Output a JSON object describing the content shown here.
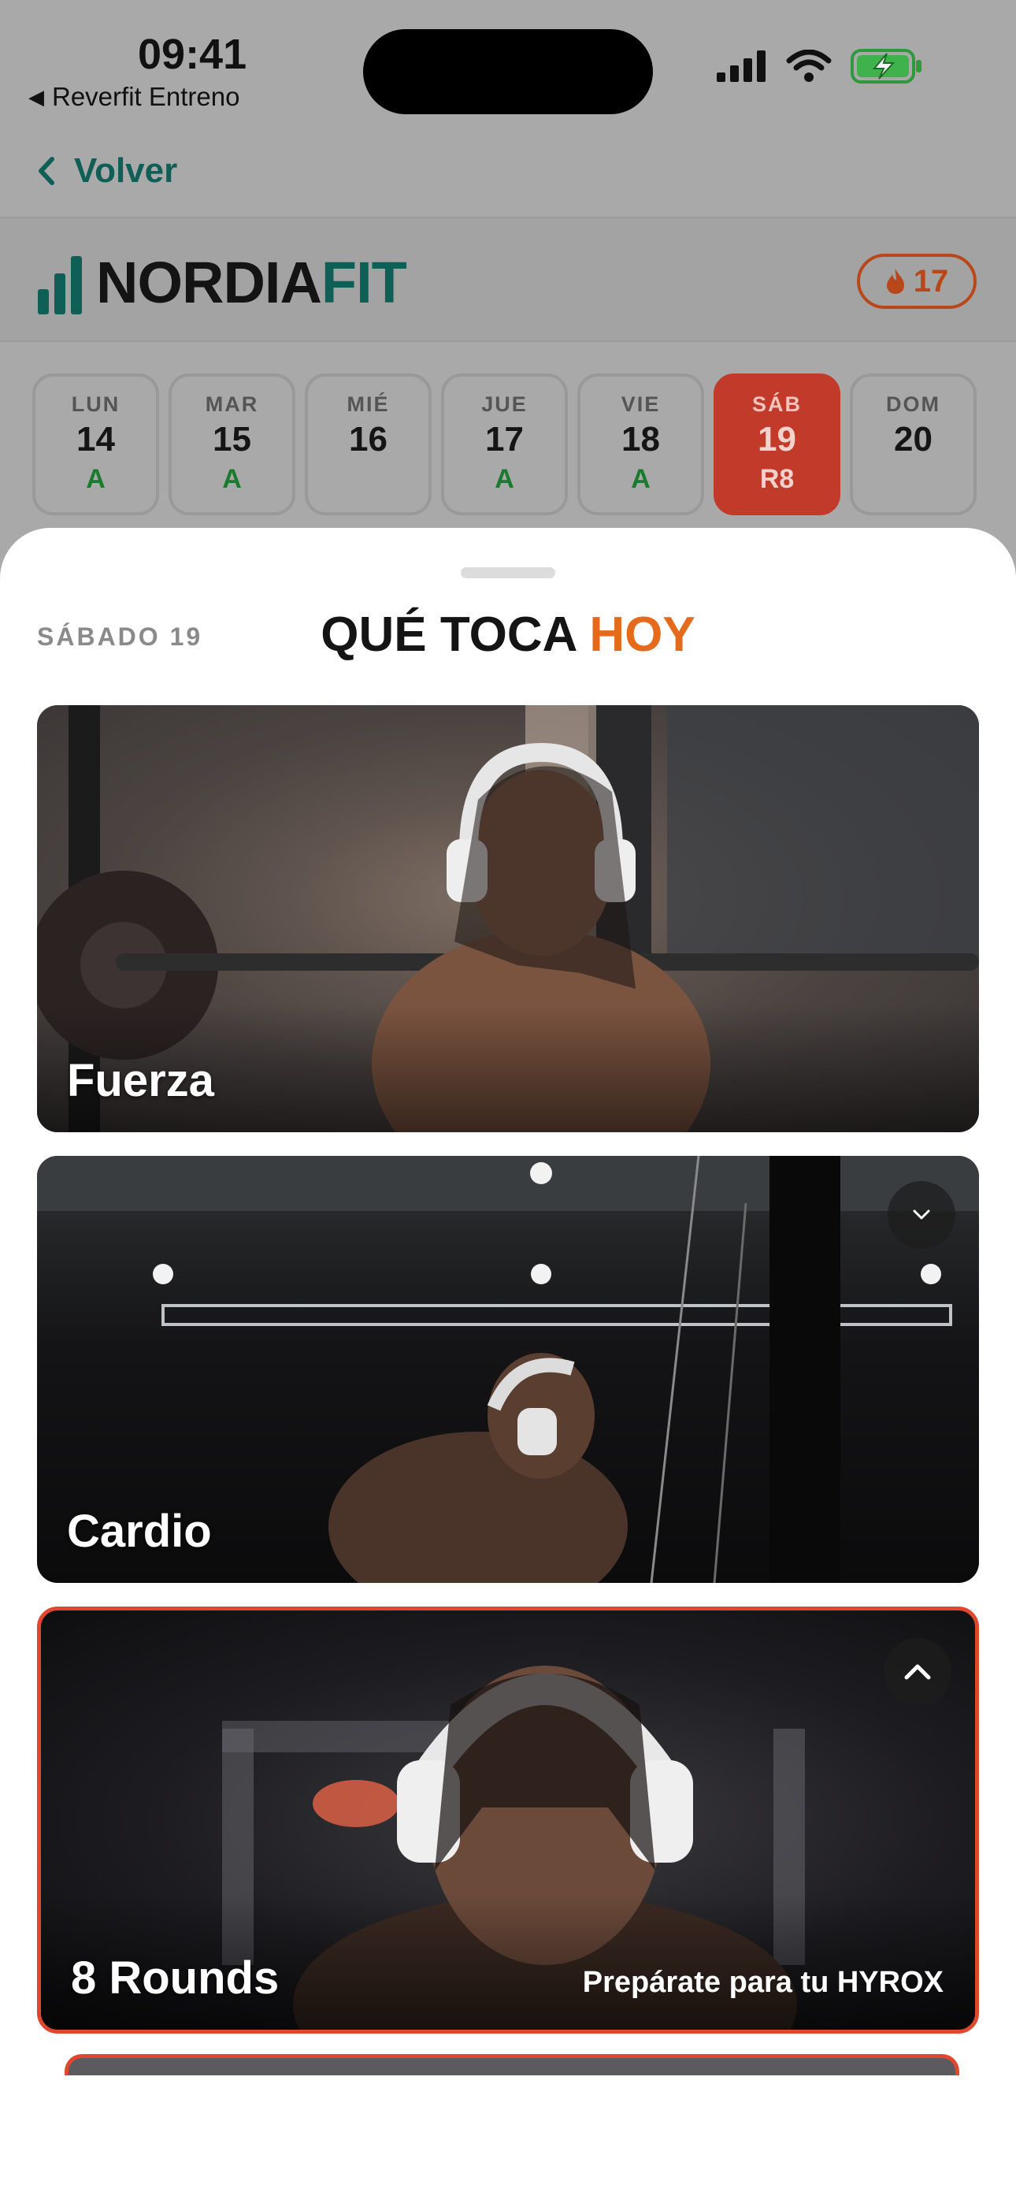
{
  "status_bar": {
    "time": "09:41",
    "back_app": "Reverfit Entreno",
    "icons": [
      "cellular-signal-icon",
      "wifi-icon",
      "battery-charging-icon"
    ]
  },
  "nav": {
    "back_label": "Volver"
  },
  "header": {
    "brand_part1": "NORDIA",
    "brand_part2": "FIT",
    "streak_count": "17",
    "streak_icon": "flame-icon"
  },
  "week": [
    {
      "name": "LUN",
      "date": "14",
      "status": "A",
      "active": false
    },
    {
      "name": "MAR",
      "date": "15",
      "status": "A",
      "active": false
    },
    {
      "name": "MIÉ",
      "date": "16",
      "status": "",
      "active": false
    },
    {
      "name": "JUE",
      "date": "17",
      "status": "A",
      "active": false
    },
    {
      "name": "VIE",
      "date": "18",
      "status": "A",
      "active": false
    },
    {
      "name": "SÁB",
      "date": "19",
      "status": "R8",
      "active": true
    },
    {
      "name": "DOM",
      "date": "20",
      "status": "",
      "active": false
    }
  ],
  "sheet": {
    "date_label": "SÁBADO 19",
    "title_part1": "QUÉ TOCA",
    "title_part2": "HOY"
  },
  "cards": [
    {
      "label": "Fuerza",
      "tag": "",
      "button": ""
    },
    {
      "label": "Cardio",
      "tag": "",
      "button": "chevron-down-icon"
    },
    {
      "label": "8 Rounds",
      "tag": "Prepárate para tu HYROX",
      "button": "chevron-up-icon"
    }
  ],
  "colors": {
    "brand_teal": "#0f5f57",
    "accent_orange": "#e56a1c",
    "active_red": "#c23a2a",
    "status_green": "#1a7a2e"
  }
}
